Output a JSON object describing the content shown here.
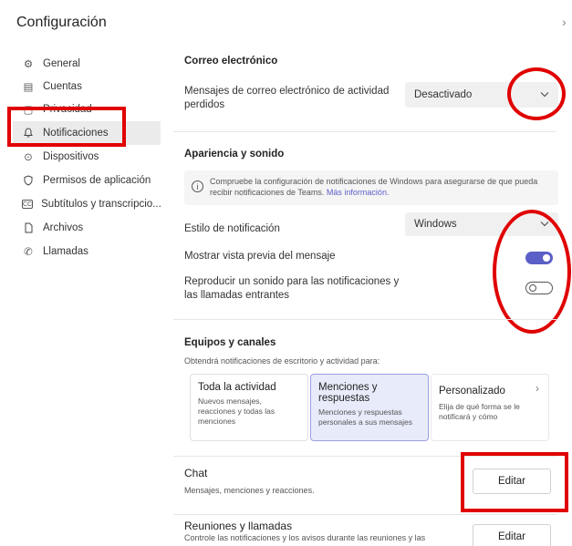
{
  "header": {
    "title": "Configuración",
    "close_glyph": "›"
  },
  "sidebar": {
    "items": [
      {
        "label": "General",
        "icon": "gear-icon",
        "glyph": "⚙"
      },
      {
        "label": "Cuentas",
        "icon": "account-card-icon",
        "glyph": "▤"
      },
      {
        "label": "Privacidad",
        "icon": "lock-icon",
        "glyph": "🔒"
      },
      {
        "label": "Notificaciones",
        "icon": "bell-icon",
        "glyph": "🔔"
      },
      {
        "label": "Dispositivos",
        "icon": "device-icon",
        "glyph": "🎧"
      },
      {
        "label": "Permisos de aplicación",
        "icon": "shield-icon",
        "glyph": "🛡"
      },
      {
        "label": "Subtítulos y transcripcio...",
        "icon": "captions-icon",
        "glyph": "CC"
      },
      {
        "label": "Archivos",
        "icon": "file-icon",
        "glyph": "🗋"
      },
      {
        "label": "Llamadas",
        "icon": "phone-icon",
        "glyph": "✆"
      }
    ]
  },
  "email": {
    "title": "Correo electrónico",
    "label": "Mensajes de correo electrónico de actividad perdidos",
    "value": "Desactivado"
  },
  "appearance": {
    "title": "Apariencia y sonido",
    "info_text": "Compruebe la configuración de notificaciones de Windows para asegurarse de que pueda recibir notificaciones de Teams.",
    "info_link": "Más información.",
    "style_label": "Estilo de notificación",
    "style_value": "Windows",
    "preview_label": "Mostrar vista previa del mensaje",
    "preview_on": true,
    "sound_label": "Reproducir un sonido para las notificaciones y las llamadas entrantes",
    "sound_on": false
  },
  "teams": {
    "title": "Equipos y canales",
    "subtitle": "Obtendrá notificaciones de escritorio y actividad para:",
    "cards": [
      {
        "title": "Toda la actividad",
        "desc": "Nuevos mensajes, reacciones y todas las menciones",
        "selected": false
      },
      {
        "title": "Menciones y respuestas",
        "desc": "Menciones y respuestas personales a sus mensajes",
        "selected": true
      },
      {
        "title": "Personalizado",
        "desc": "Elija de qué forma se le notificará y cómo",
        "selected": false,
        "chevron": "›"
      }
    ]
  },
  "chat": {
    "title": "Chat",
    "desc": "Mensajes, menciones y reacciones.",
    "button": "Editar"
  },
  "meetings": {
    "title": "Reuniones y llamadas",
    "desc": "Controle las notificaciones y los avisos durante las reuniones y las",
    "button": "Editar"
  },
  "colors": {
    "accent": "#5b5fc7",
    "annotation": "#e00000",
    "selected_card": "#e8ebfa"
  }
}
